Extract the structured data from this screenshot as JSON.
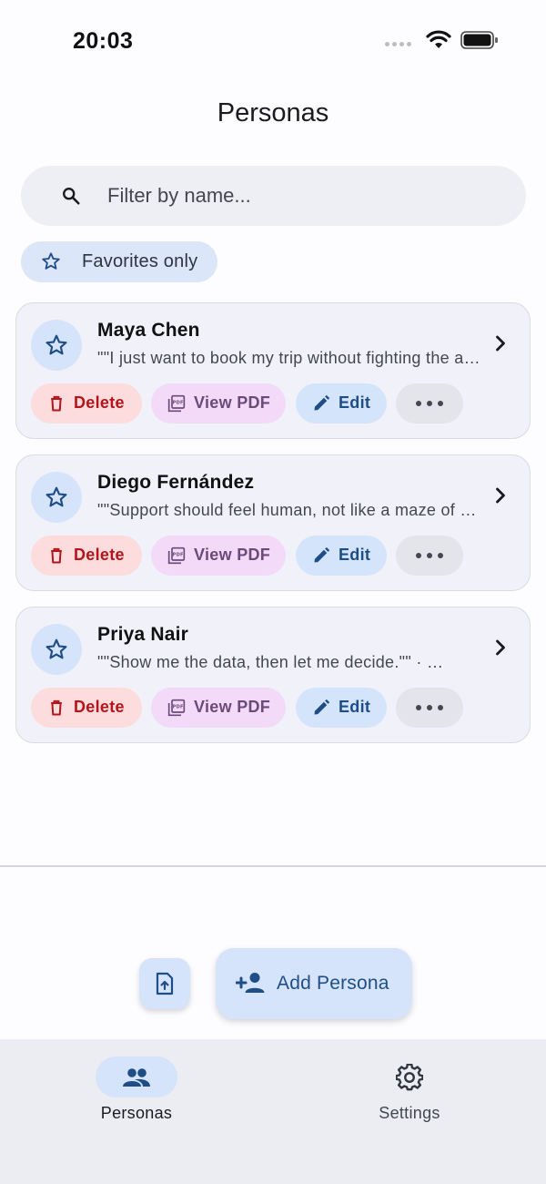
{
  "status_bar": {
    "time": "20:03"
  },
  "page": {
    "title": "Personas"
  },
  "search": {
    "placeholder": "Filter by name..."
  },
  "favorites_chip": {
    "label": "Favorites only"
  },
  "personas": [
    {
      "name": "Maya Chen",
      "quote": "\"\"I just want to book my trip without fighting the app.\"\""
    },
    {
      "name": "Diego Fernández",
      "quote": "\"\"Support should feel human, not like a maze of menus.\"\""
    },
    {
      "name": "Priya Nair",
      "quote": "\"\"Show me the data, then let me decide.\"\"  ·  …"
    }
  ],
  "card_actions": {
    "delete": "Delete",
    "view_pdf": "View PDF",
    "edit": "Edit"
  },
  "fab": {
    "add_label": "Add Persona"
  },
  "bottom_nav": {
    "personas": "Personas",
    "settings": "Settings"
  },
  "colors": {
    "accent": "#1f4e87",
    "delete": "#b3151b",
    "pdf": "#6c4a7a",
    "chip_bg": "#d6e4fb"
  },
  "icons": [
    "search-icon",
    "star-outline-icon",
    "chevron-right-icon",
    "trash-icon",
    "pdf-icon",
    "pencil-icon",
    "more-icon",
    "upload-icon",
    "add-person-icon",
    "people-icon",
    "gear-icon"
  ]
}
